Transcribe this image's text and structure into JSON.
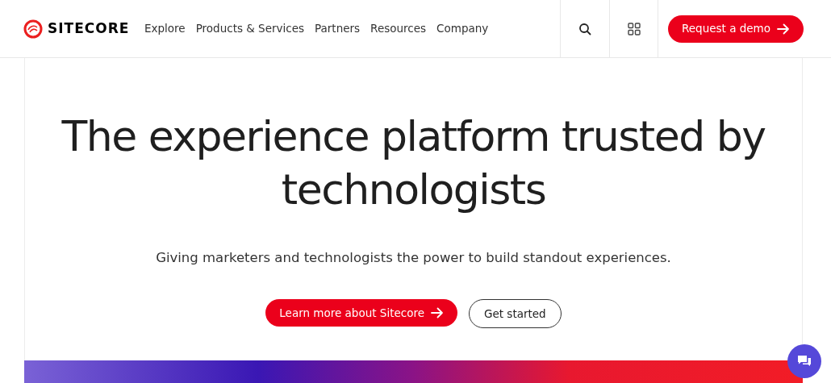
{
  "header": {
    "logo": "SITECORE",
    "nav": [
      "Explore",
      "Products & Services",
      "Partners",
      "Resources",
      "Company"
    ],
    "demo_button": "Request a demo"
  },
  "hero": {
    "headline": "The experience platform trusted by technologists",
    "subtitle": "Giving marketers and technologists the power to build standout experiences.",
    "buttons": [
      {
        "label": "Learn more about Sitecore",
        "kind": "primary"
      },
      {
        "label": "Get started",
        "kind": "outline"
      }
    ]
  }
}
